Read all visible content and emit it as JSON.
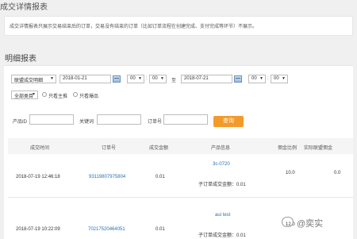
{
  "page_title": "成交详情报表",
  "notice": "成交详情报表只展示交易结束后的订单，交易没有结束的订单（比如订单流程在创建完成、支付完成等环节）不展示。",
  "section_title": "明细报表",
  "filters": {
    "type_select": "联盟成交明细",
    "start_date": "2018-01-21",
    "start_hour": "00",
    "start_min": "00",
    "to_label": "至",
    "end_date": "2018-07-21",
    "end_hour": "00",
    "end_min": "00",
    "category_select": "全部类目",
    "radio_main": "只看主推",
    "radio_hot": "只看爆品",
    "product_id_label": "产品ID",
    "keyword_label": "关键词",
    "order_no_label": "订单号",
    "query_button": "查询"
  },
  "table": {
    "headers": [
      "成交时间",
      "订单号",
      "成交金额",
      "产品信息",
      "佣金比例",
      "实际联盟佣金"
    ],
    "rows": [
      {
        "time": "2018-07-19 12:46:18",
        "order_no": "93119807975804",
        "amount": "0.01",
        "product": "3c-0720",
        "sub_amount": "子订单成交金额：0.01",
        "ratio": "10.0",
        "commission": "0.0"
      },
      {
        "time": "2018-07-19 10:22:09",
        "order_no": "70217520464051",
        "amount": "0.01",
        "product": "aui test",
        "sub_amount": "子订单成交金额：0.01",
        "ratio": "12.0",
        "commission": ""
      }
    ]
  },
  "watermark": "@奕实",
  "colors": {
    "accent": "#f39a2b",
    "link": "#2a6fb3"
  }
}
